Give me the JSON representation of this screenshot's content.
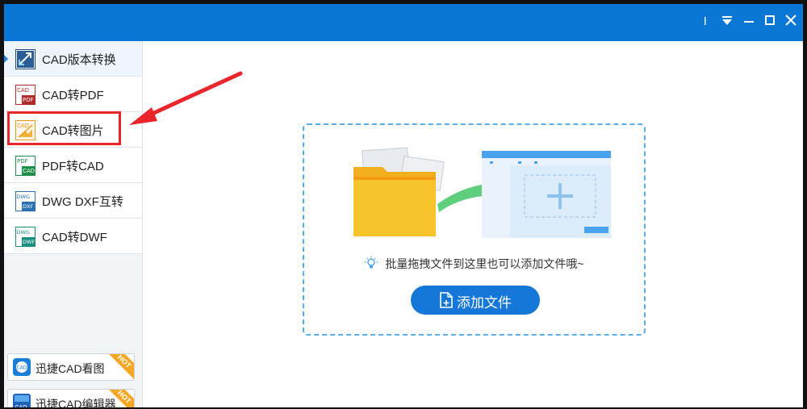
{
  "sidebar": {
    "items": [
      {
        "label": "CAD版本转换",
        "icon": "cad-version-icon",
        "active": true
      },
      {
        "label": "CAD转PDF",
        "icon": "cad-to-pdf-icon"
      },
      {
        "label": "CAD转图片",
        "icon": "cad-to-image-icon"
      },
      {
        "label": "PDF转CAD",
        "icon": "pdf-to-cad-icon"
      },
      {
        "label": "DWG DXF互转",
        "icon": "dwg-dxf-icon"
      },
      {
        "label": "CAD转DWF",
        "icon": "cad-to-dwf-icon"
      }
    ],
    "promos": [
      {
        "label": "迅捷CAD看图",
        "badge": "HOT"
      },
      {
        "label": "迅捷CAD编辑器",
        "badge": "HOT"
      }
    ]
  },
  "dropzone": {
    "hint": "批量拖拽文件到这里也可以添加文件哦~",
    "button_label": "添加文件"
  },
  "icon_text": {
    "cad": "CAD",
    "pdf": "PDF",
    "dwg": "DWG",
    "dxf": "DXF",
    "dwf": "DWF"
  },
  "colors": {
    "titlebar": "#0a77d5",
    "accent": "#1577d8",
    "highlight": "#e8262c",
    "folder": "#f7c52b",
    "arrow": "#5fcf7e"
  }
}
